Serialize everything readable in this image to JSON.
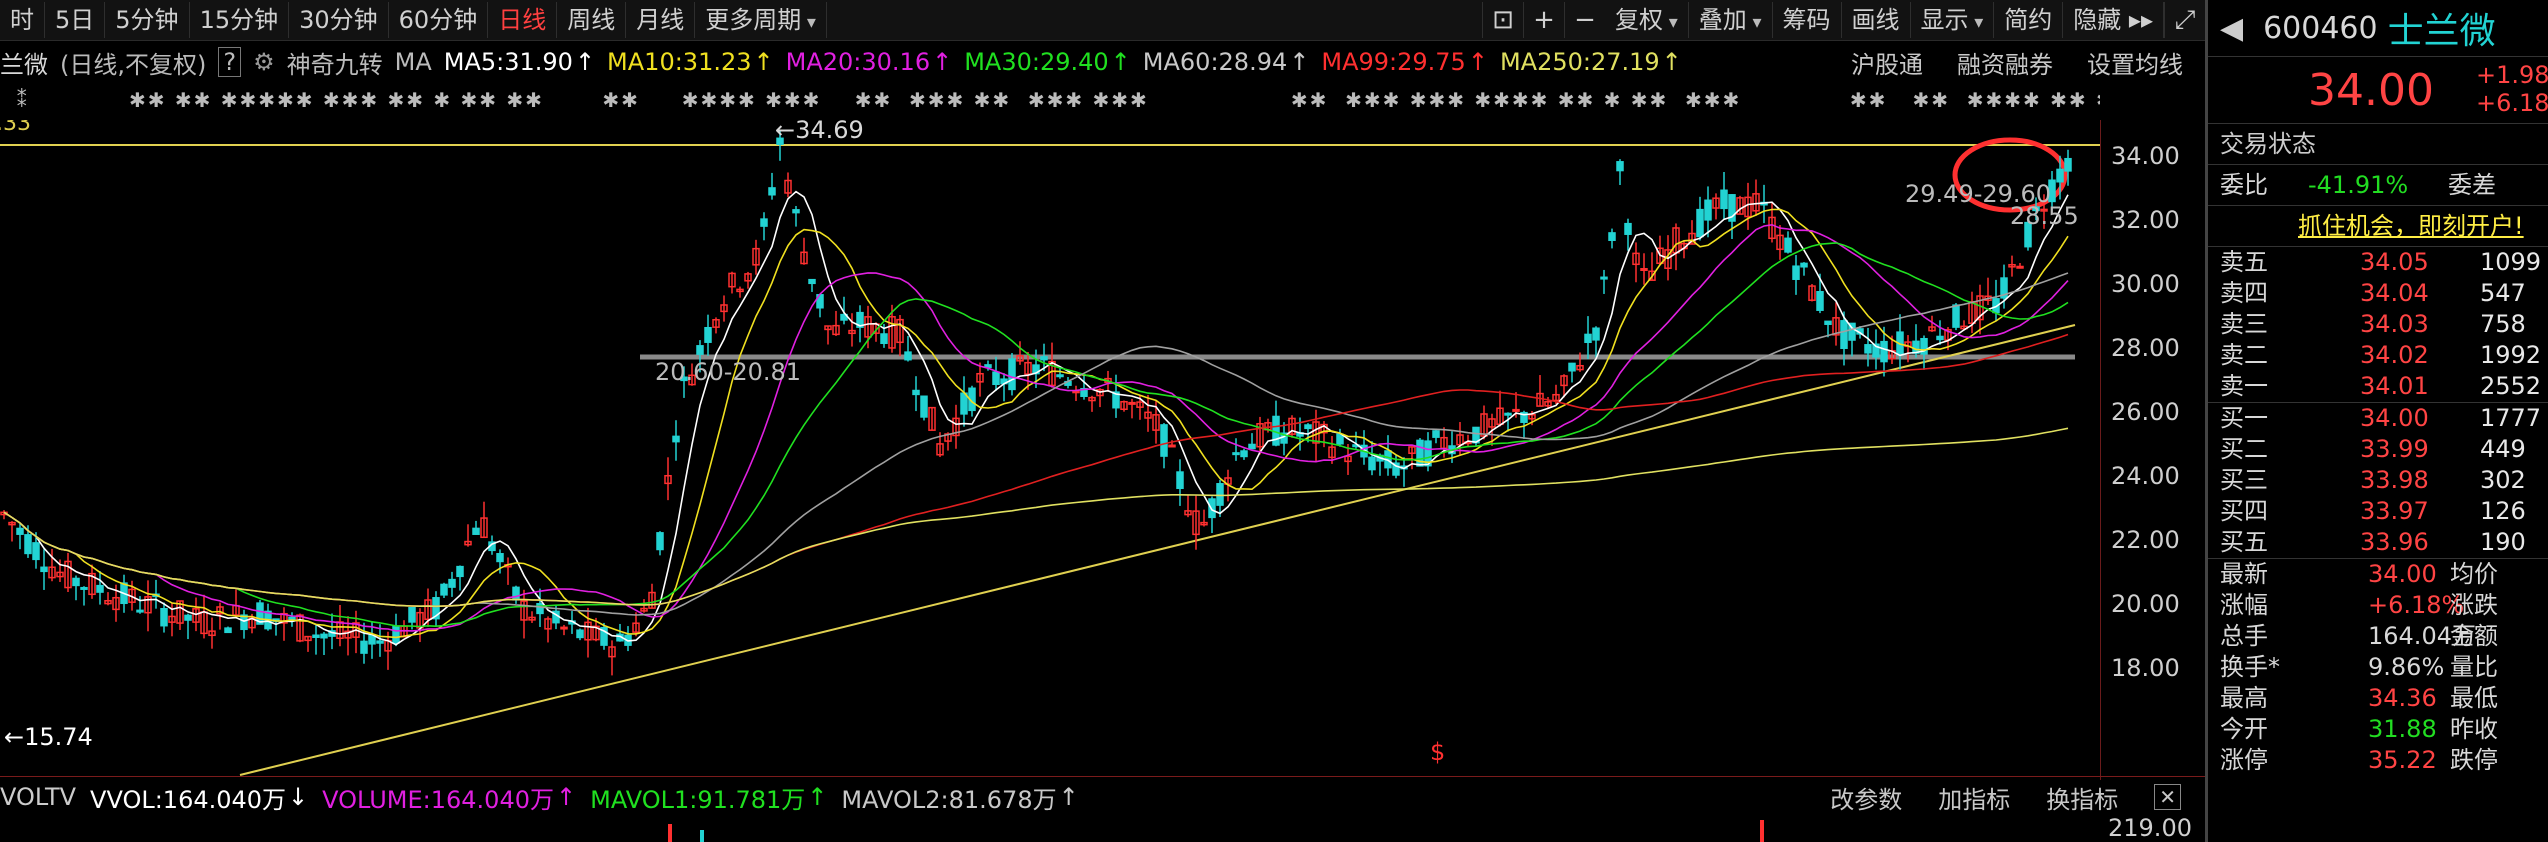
{
  "toolbar": {
    "periods": [
      "时",
      "5日",
      "5分钟",
      "15分钟",
      "30分钟",
      "60分钟",
      "日线",
      "周线",
      "月线",
      "更多周期"
    ],
    "active_period": "日线",
    "tools": [
      "复权",
      "叠加",
      "筹码",
      "画线",
      "显示",
      "简约",
      "隐藏"
    ]
  },
  "indicator_bar": {
    "stock": "兰微",
    "mode": "(日线,不复权)",
    "help": "?",
    "gear_label": "神奇九转",
    "ma": "MA",
    "ma5": "MA5:31.90",
    "ma10": "MA10:31.23",
    "ma20": "MA20:30.16",
    "ma30": "MA30:29.40",
    "ma60": "MA60:28.94",
    "ma99": "MA99:29.75",
    "ma250": "MA250:27.19",
    "links": [
      "沪股通",
      "融资融券",
      "设置均线"
    ]
  },
  "chart": {
    "left_top_value": ".33",
    "high_label": "←34.69",
    "box_label": "20.60-20.81",
    "right_label1": "29.49-29.60",
    "right_label2": "28.55",
    "low_label": "←15.74",
    "yticks": [
      "34.00",
      "32.00",
      "30.00",
      "28.00",
      "26.00",
      "24.00",
      "22.00",
      "20.00",
      "18.00"
    ],
    "colors": {
      "up": "#ff3030",
      "down": "#22d3d3",
      "ma5": "#ffffff",
      "ma10": "#f0e020",
      "ma20": "#e020e0",
      "ma30": "#20e020",
      "ma60": "#a0a0a0",
      "ma99": "#e02020",
      "ma250": "#e0e060"
    }
  },
  "volume_bar": {
    "name": "VOLTV",
    "vvol": "VVOL:164.040万",
    "volume": "VOLUME:164.040万",
    "mavol1": "MAVOL1:91.781万",
    "mavol2": "MAVOL2:81.678万",
    "links": [
      "改参数",
      "加指标",
      "换指标"
    ],
    "ytick": "219.00"
  },
  "quote": {
    "code": "600460",
    "name": "士兰微",
    "price": "34.00",
    "change": "+1.98",
    "change_pct": "+6.18",
    "status": "交易状态",
    "weibi_label": "委比",
    "weibi": "-41.91%",
    "weicha_label": "委差",
    "promo": "抓住机会，即刻开户!",
    "asks": [
      {
        "label": "卖五",
        "price": "34.05",
        "vol": "1099"
      },
      {
        "label": "卖四",
        "price": "34.04",
        "vol": "547"
      },
      {
        "label": "卖三",
        "price": "34.03",
        "vol": "758"
      },
      {
        "label": "卖二",
        "price": "34.02",
        "vol": "1992"
      },
      {
        "label": "卖一",
        "price": "34.01",
        "vol": "2552"
      }
    ],
    "bids": [
      {
        "label": "买一",
        "price": "34.00",
        "vol": "1777"
      },
      {
        "label": "买二",
        "price": "33.99",
        "vol": "449"
      },
      {
        "label": "买三",
        "price": "33.98",
        "vol": "302"
      },
      {
        "label": "买四",
        "price": "33.97",
        "vol": "126"
      },
      {
        "label": "买五",
        "price": "33.96",
        "vol": "190"
      }
    ],
    "stats": [
      {
        "l": "最新",
        "v": "34.00",
        "r": "均价",
        "c": "#ff4444"
      },
      {
        "l": "涨幅",
        "v": "+6.18%",
        "r": "涨跌",
        "c": "#ff4444"
      },
      {
        "l": "总手",
        "v": "164.04万",
        "r": "金额",
        "c": "#d8d8d8"
      },
      {
        "l": "换手*",
        "v": "9.86%",
        "r": "量比",
        "c": "#d8d8d8"
      },
      {
        "l": "最高",
        "v": "34.36",
        "r": "最低",
        "c": "#ff4444"
      },
      {
        "l": "今开",
        "v": "31.88",
        "r": "昨收",
        "c": "#22dd22"
      },
      {
        "l": "涨停",
        "v": "35.22",
        "r": "跌停",
        "c": "#ff4444"
      }
    ]
  }
}
